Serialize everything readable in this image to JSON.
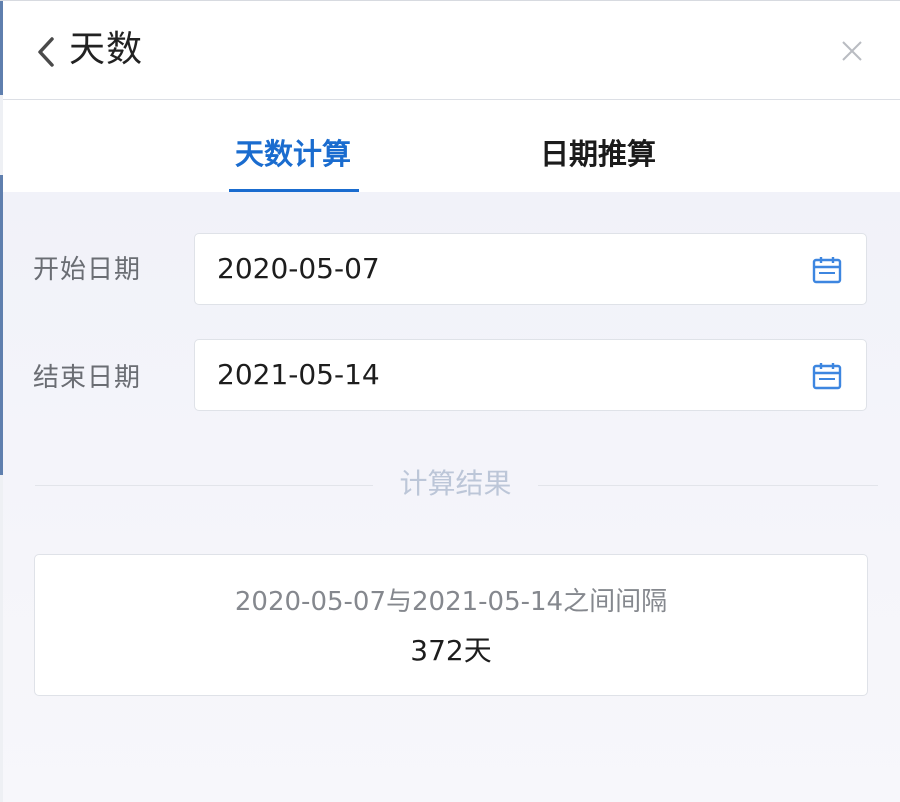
{
  "header": {
    "title": "天数",
    "back_icon": "chevron-left-icon",
    "close_icon": "close-icon"
  },
  "tabs": [
    {
      "label": "天数计算",
      "active": true
    },
    {
      "label": "日期推算",
      "active": false
    }
  ],
  "form": {
    "start_label": "开始日期",
    "start_value": "2020-05-07",
    "end_label": "结束日期",
    "end_value": "2021-05-14",
    "calendar_icon": "calendar-icon"
  },
  "result": {
    "section_label": "计算结果",
    "description": "2020-05-07与2021-05-14之间间隔",
    "value": "372天"
  },
  "colors": {
    "accent": "#1a6ccf",
    "icon": "#3d86e0",
    "label": "#6a6d73",
    "divider_text": "#bcc6d8",
    "background": "#f3f4fa"
  }
}
